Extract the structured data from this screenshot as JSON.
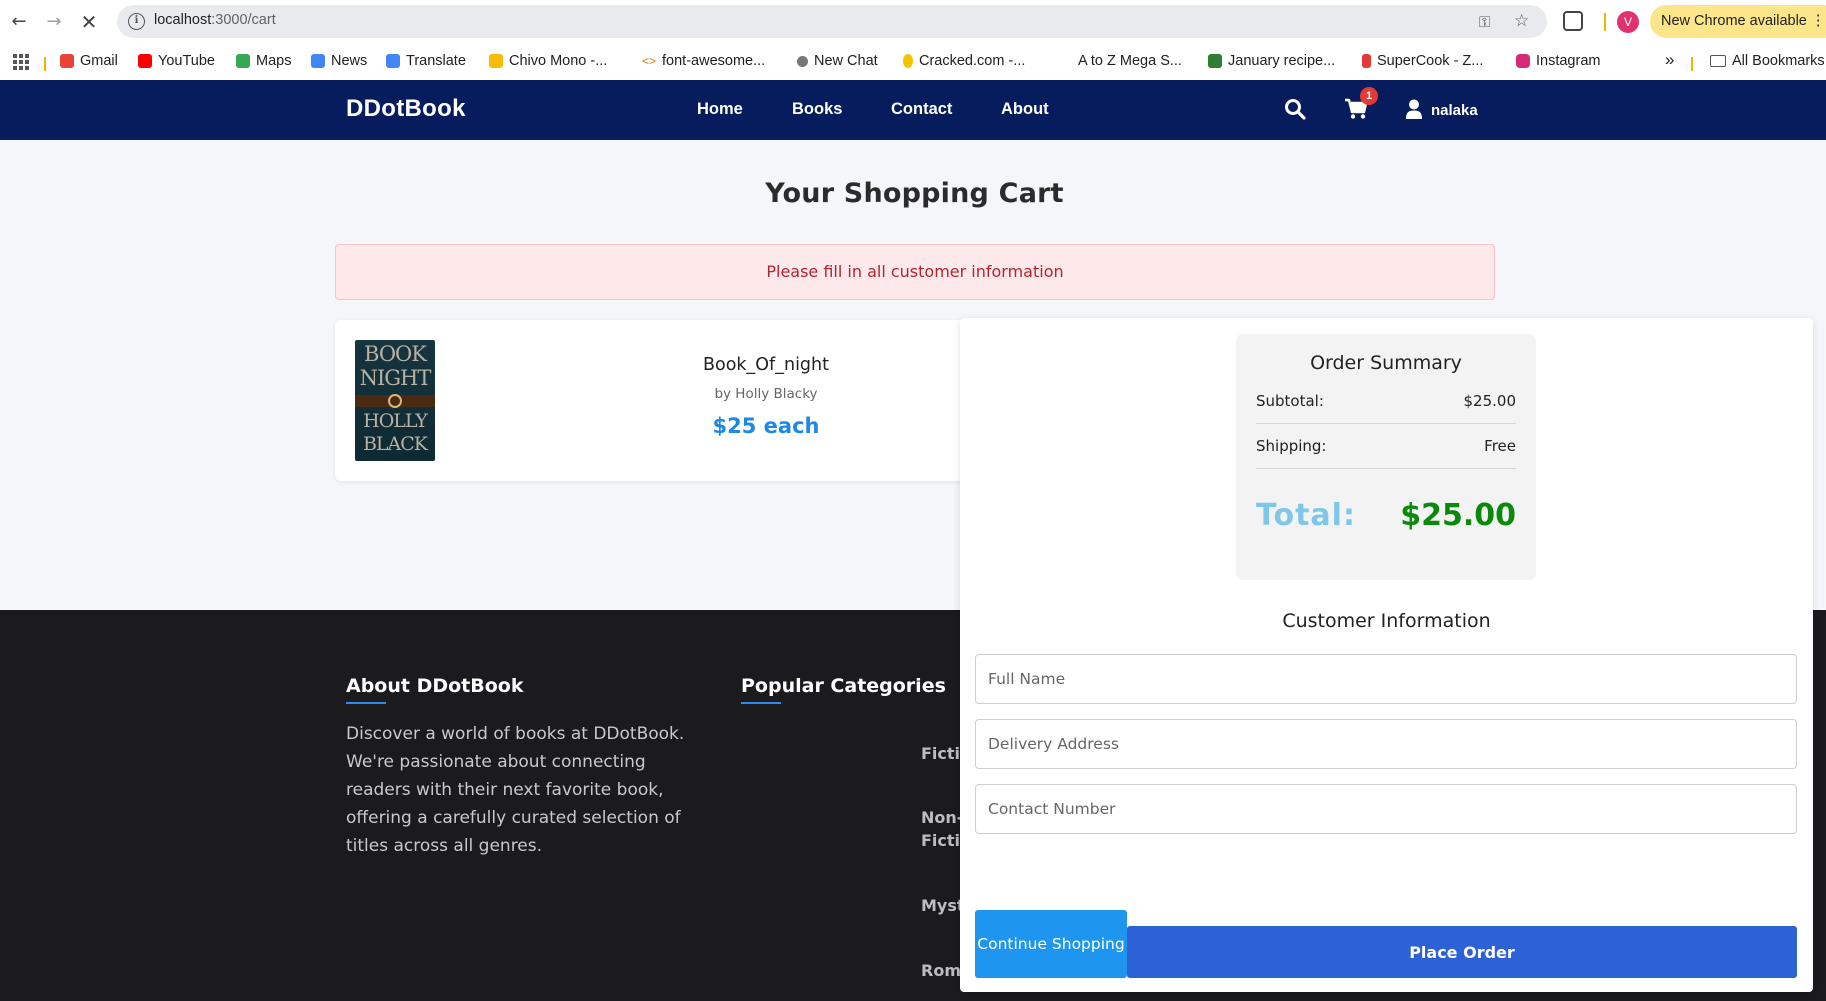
{
  "browser": {
    "url_host": "localhost",
    "url_path": ":3000/cart",
    "update_label": "New Chrome available",
    "profile_initial": "V",
    "bookmarks": [
      {
        "label": "Gmail",
        "color": "#ea4335"
      },
      {
        "label": "YouTube",
        "color": "#ff0000"
      },
      {
        "label": "Maps",
        "color": "#34a853"
      },
      {
        "label": "News",
        "color": "#4285f4"
      },
      {
        "label": "Translate",
        "color": "#4285f4"
      },
      {
        "label": "Chivo Mono -...",
        "color": "#fbbc05"
      },
      {
        "label": "font-awesome...",
        "color": "#e8710a"
      },
      {
        "label": "New Chat",
        "color": "#777777"
      },
      {
        "label": "Cracked.com -...",
        "color": "#f5c400"
      },
      {
        "label": "A to Z Mega S...",
        "color": "#ffffff"
      },
      {
        "label": "January recipe...",
        "color": "#2e7d32"
      },
      {
        "label": "SuperCook - Z...",
        "color": "#e53935"
      },
      {
        "label": "Instagram",
        "color": "#d62976"
      }
    ],
    "more_label": "»",
    "all_bookmarks": "All Bookmarks"
  },
  "site": {
    "brand": "DDotBook",
    "nav": [
      "Home",
      "Books",
      "Contact",
      "About"
    ],
    "cart_count": "1",
    "user": "nalaka"
  },
  "cart": {
    "title": "Your Shopping Cart",
    "alert": "Please fill in all customer information",
    "item": {
      "cover_title": "BOOK of NIGHT",
      "cover_author": "HOLLY BLACK",
      "title": "Book_Of_night",
      "author": "by Holly Blacky",
      "price": "$25 each"
    },
    "summary": {
      "title": "Order Summary",
      "subtotal_label": "Subtotal:",
      "subtotal_value": "$25.00",
      "shipping_label": "Shipping:",
      "shipping_value": "Free",
      "total_label": "Total:",
      "total_value": "$25.00"
    },
    "customer": {
      "title": "Customer Information",
      "name_placeholder": "Full Name",
      "address_placeholder": "Delivery Address",
      "phone_placeholder": "Contact Number"
    },
    "continue_label": "Continue Shopping",
    "place_order_label": "Place Order"
  },
  "footer": {
    "about_title": "About DDotBook",
    "about_text": "Discover a world of books at DDotBook. We're passionate about connecting readers with their next favorite book, offering a carefully curated selection of titles across all genres.",
    "categories_title": "Popular Categories",
    "categories": [
      "Fiction",
      "Non-Fiction",
      "Mystery",
      "Romance"
    ]
  },
  "colors": {
    "header_bg": "#061c5c",
    "price_blue": "#1e88e5",
    "total_green": "#0a8a0a",
    "place_order_bg": "#2d62d6",
    "continue_bg": "#1e96f0",
    "alert_bg": "#fde8ea",
    "footer_bg": "#1b1b1d"
  }
}
